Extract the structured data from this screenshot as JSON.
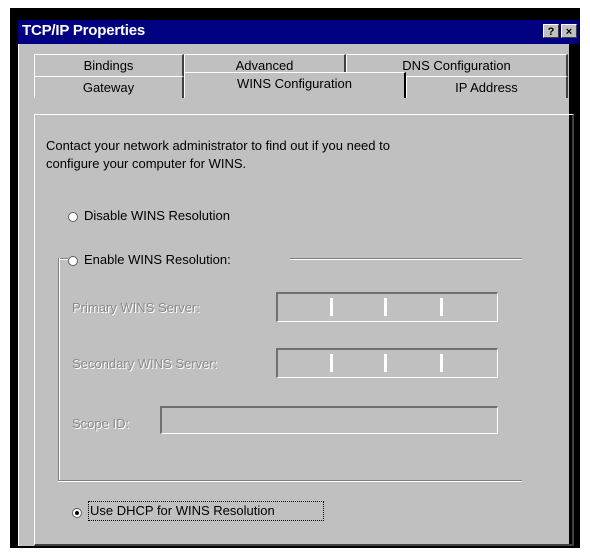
{
  "window": {
    "title": "TCP/IP Properties",
    "help_button": "?",
    "close_button": "×"
  },
  "tabs": {
    "row1": [
      "Bindings",
      "Advanced",
      "DNS Configuration"
    ],
    "row2": [
      "Gateway",
      "WINS Configuration",
      "IP Address"
    ],
    "active": "WINS Configuration"
  },
  "panel": {
    "info_line1": "Contact your network administrator to find out if you need to",
    "info_line2": "configure your computer for WINS.",
    "disable_label": "Disable WINS Resolution",
    "enable_label": "Enable WINS Resolution:",
    "primary_label": "Primary WINS Server:",
    "secondary_label": "Secondary WINS Server:",
    "scope_label": "Scope ID:",
    "dhcp_label": "Use DHCP for WINS Resolution",
    "selected_option": "Use DHCP for WINS Resolution"
  }
}
